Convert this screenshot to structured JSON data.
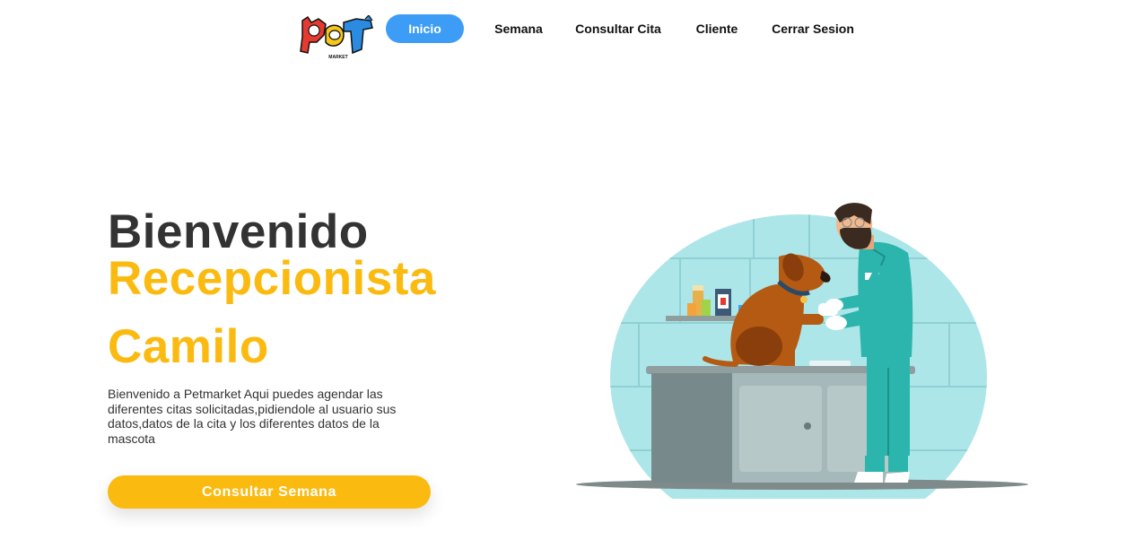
{
  "nav": {
    "logo_text": "Pet",
    "logo_subtext": "MARKET",
    "items": [
      {
        "label": "Inicio",
        "active": true
      },
      {
        "label": "Semana",
        "active": false
      },
      {
        "label": "Consultar Cita",
        "active": false
      },
      {
        "label": "Cliente",
        "active": false
      },
      {
        "label": "Cerrar Sesion",
        "active": false
      }
    ]
  },
  "hero": {
    "title": "Bienvenido",
    "role": "Recepcionista",
    "name": "Camilo",
    "description": "Bienvenido a Petmarket Aqui puedes agendar las diferentes citas solicitadas,pidiendole al usuario sus datos,datos de la cita y los diferentes datos de la mascota",
    "cta_label": "Consultar Semana"
  },
  "illustration": {
    "icon": "vet-with-dog-illustration"
  },
  "colors": {
    "accent_yellow": "#fbba10",
    "nav_active_blue": "#3d9df6",
    "title_dark": "#333333"
  }
}
